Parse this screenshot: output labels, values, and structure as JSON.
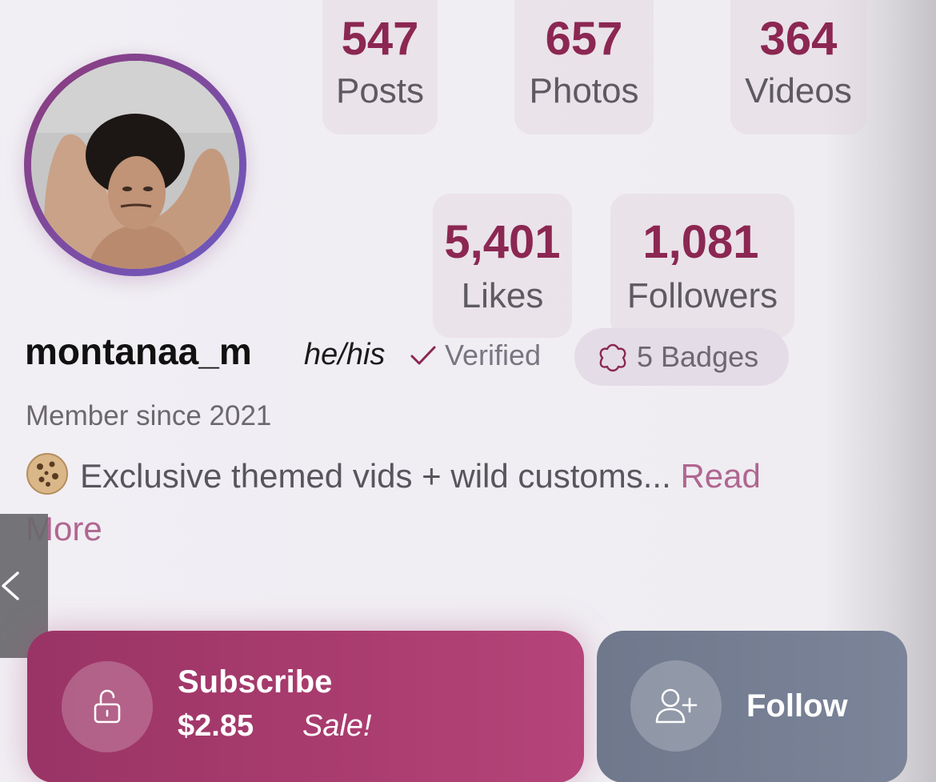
{
  "stats": {
    "posts": {
      "value": "547",
      "label": "Posts"
    },
    "photos": {
      "value": "657",
      "label": "Photos"
    },
    "videos": {
      "value": "364",
      "label": "Videos"
    },
    "likes": {
      "value": "5,401",
      "label": "Likes"
    },
    "followers": {
      "value": "1,081",
      "label": "Followers"
    }
  },
  "profile": {
    "username": "montanaa_m",
    "pronouns": "he/his",
    "verified_label": "Verified",
    "badges_label": "5 Badges",
    "member_since": "Member since 2021",
    "bio": "Exclusive themed vids + wild customs...",
    "read_more": "Read More"
  },
  "actions": {
    "subscribe_label": "Subscribe",
    "subscribe_price": "$2.85",
    "subscribe_sale": "Sale!",
    "follow_label": "Follow"
  },
  "icons": {
    "verified": "check-icon",
    "badges": "flower-badge-icon",
    "bio": "cookie-emoji",
    "back": "chevron-left-icon",
    "subscribe": "lock-open-icon",
    "follow": "user-plus-icon"
  },
  "colors": {
    "accent": "#8b2752",
    "subscribe_bg": "#a93c6e",
    "follow_bg": "#747d91",
    "link": "#b06690"
  }
}
